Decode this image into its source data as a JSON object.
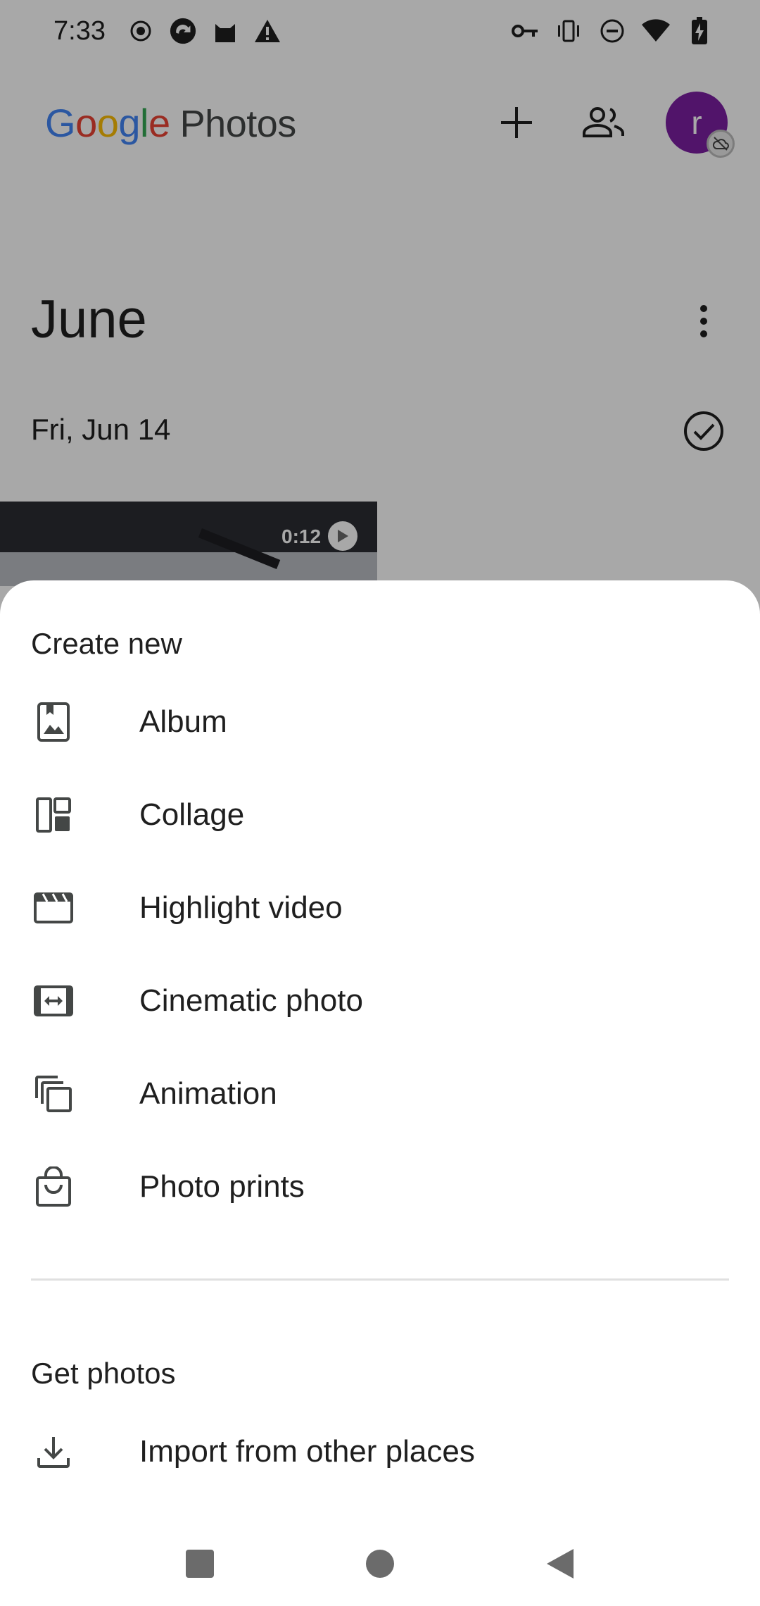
{
  "status_bar": {
    "time": "7:33",
    "left_icons": [
      "record-icon",
      "sync-app-icon",
      "cat-app-icon",
      "alert-icon"
    ],
    "right_icons": [
      "vpn-key-icon",
      "vibrate-icon",
      "dnd-icon",
      "wifi-icon",
      "battery-charging-icon"
    ]
  },
  "header": {
    "logo_google": "Google",
    "logo_product": "Photos",
    "actions": [
      "add-icon",
      "shared-people-icon"
    ],
    "avatar_letter": "r"
  },
  "timeline": {
    "month": "June",
    "date": "Fri, Jun 14",
    "video_duration": "0:12"
  },
  "sheet": {
    "create_title": "Create new",
    "create_items": [
      {
        "label": "Album",
        "icon": "album-icon"
      },
      {
        "label": "Collage",
        "icon": "collage-icon"
      },
      {
        "label": "Highlight video",
        "icon": "highlight-video-icon"
      },
      {
        "label": "Cinematic photo",
        "icon": "cinematic-photo-icon"
      },
      {
        "label": "Animation",
        "icon": "animation-icon"
      },
      {
        "label": "Photo prints",
        "icon": "photo-prints-icon"
      }
    ],
    "get_title": "Get photos",
    "get_items": [
      {
        "label": "Import from other places",
        "icon": "import-icon"
      }
    ]
  },
  "colors": {
    "avatar": "#7b1fa2",
    "scrim": "rgba(0,0,0,0.34)",
    "text": "#1f1f1f"
  }
}
